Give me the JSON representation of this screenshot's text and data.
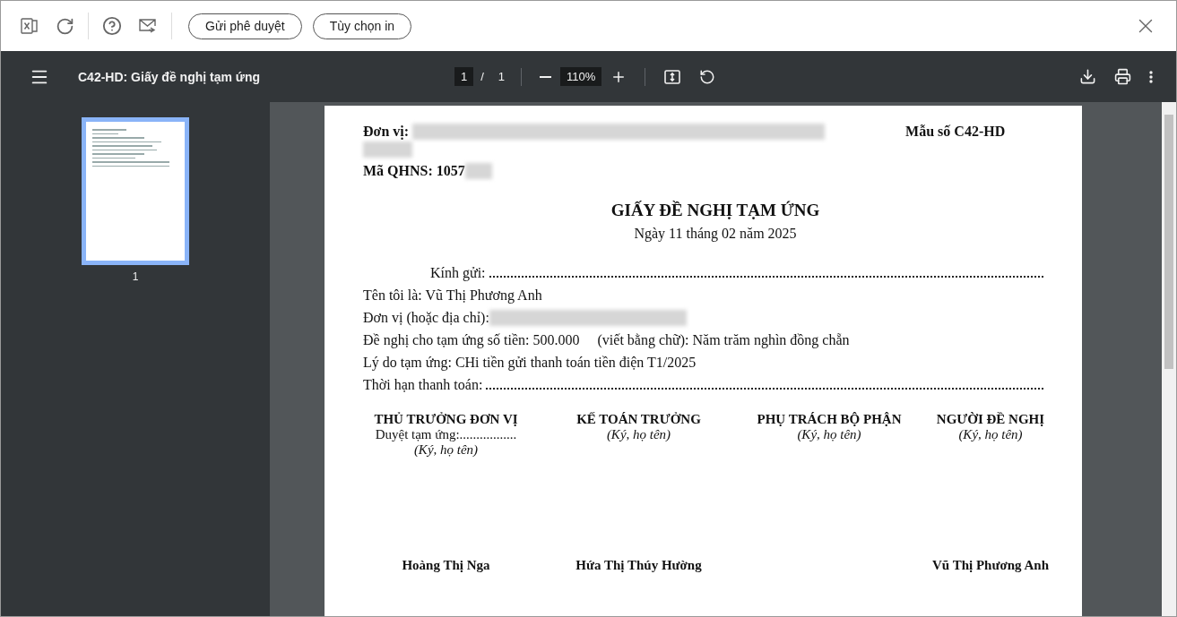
{
  "toolbar": {
    "buttons": [
      "Gửi phê duyệt",
      "Tùy chọn in"
    ]
  },
  "viewer": {
    "title": "C42-HD: Giấy đề nghị tạm ứng",
    "page_current": "1",
    "page_separator": "/",
    "page_total": "1",
    "zoom": "110%"
  },
  "thumbnails": [
    {
      "label": "1",
      "selected": true
    }
  ],
  "document": {
    "unit_label": "Đơn vị:",
    "form_code": "Mẫu số C42-HD",
    "qhns_label": "Mã QHNS: 1057",
    "title": "GIẤY ĐỀ NGHỊ TẠM ỨNG",
    "date": "Ngày 11 tháng 02 năm 2025",
    "lines": [
      {
        "kind": "fill",
        "label": "Kính gửi:"
      },
      {
        "kind": "text",
        "text": "Tên tôi là: Vũ Thị Phương Anh"
      },
      {
        "kind": "redacted",
        "label": "Đơn vị (hoặc địa chỉ):"
      },
      {
        "kind": "amount",
        "label": "Đề nghị cho tạm ứng số tiền: 500.000",
        "words": "(viết bằng chữ): Năm trăm nghìn đồng chẵn"
      },
      {
        "kind": "text",
        "text": "Lý do tạm ứng: CHi tiền gửi thanh toán tiền điện T1/2025"
      },
      {
        "kind": "fill",
        "label": "Thời hạn thanh toán:"
      }
    ],
    "signatures": [
      {
        "title": "THỦ TRƯỞNG ĐƠN VỊ",
        "approval": "Duyệt tạm ứng:.................",
        "hint": "(Ký, họ tên)",
        "name": "Hoàng Thị Nga"
      },
      {
        "title": "KẾ TOÁN TRƯỞNG",
        "hint": "(Ký, họ tên)",
        "name": "Hứa Thị Thúy Hường"
      },
      {
        "title": "PHỤ TRÁCH BỘ PHẬN",
        "hint": "(Ký, họ tên)"
      },
      {
        "title": "NGƯỜI ĐỀ NGHỊ",
        "hint": "(Ký, họ tên)",
        "name": "Vũ Thị Phương Anh"
      }
    ]
  }
}
